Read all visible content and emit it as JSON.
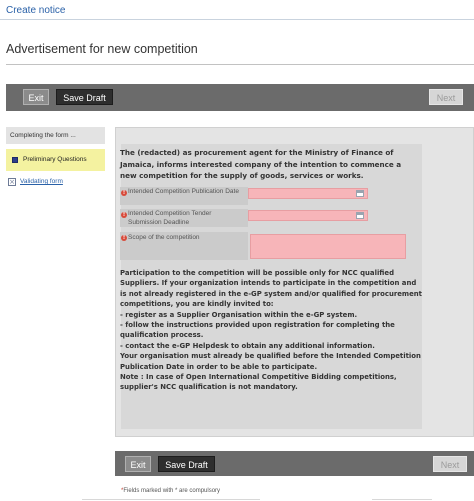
{
  "breadcrumb": "Create notice",
  "page_title": "Advertisement for new competition",
  "toolbar": {
    "exit": "Exit",
    "save_draft": "Save Draft",
    "next": "Next"
  },
  "sidebar": {
    "heading": "Completing the form ...",
    "items": [
      {
        "label": "Preliminary Questions",
        "active": true
      },
      {
        "label": "Validating form",
        "active": false
      }
    ]
  },
  "form": {
    "intro": "The (redacted) as procurement agent for the Ministry of Finance of Jamaica, informs interested company of the intention to commence a new competition for the supply of goods, services or works.",
    "fields": [
      {
        "label": "Intended Competition Publication Date",
        "value": ""
      },
      {
        "label": "Intended Competition Tender Submission Deadline",
        "value": ""
      },
      {
        "label": "Scope of the competition",
        "value": ""
      }
    ],
    "body_lines": [
      "Participation to the competition will be possible only for NCC qualified Suppliers. If your organization intends to participate in the competition and is not already registered in the e-GP system and/or qualified for procurement competitions, you are kindly invited to:",
      "- register as a Supplier Organisation within the e-GP system.",
      "- follow the instructions provided upon registration for completing the qualification process.",
      "- contact the e-GP Helpdesk to obtain any additional information.",
      "Your organisation must already be qualified before the Intended Competition Publication Date in order to be able to participate.",
      "Note : In case of Open International Competitive Bidding competitions, supplier's NCC qualification is not mandatory."
    ]
  },
  "footer": {
    "asterisk": "*",
    "note": "Fields marked with * are compulsory"
  },
  "colors": {
    "accent_link": "#2a61a8",
    "toolbar_bg": "#6b6b6b",
    "active_sidebar": "#f4f2a0",
    "required_input": "#f7b5b9",
    "error_icon": "#d84a3a"
  }
}
